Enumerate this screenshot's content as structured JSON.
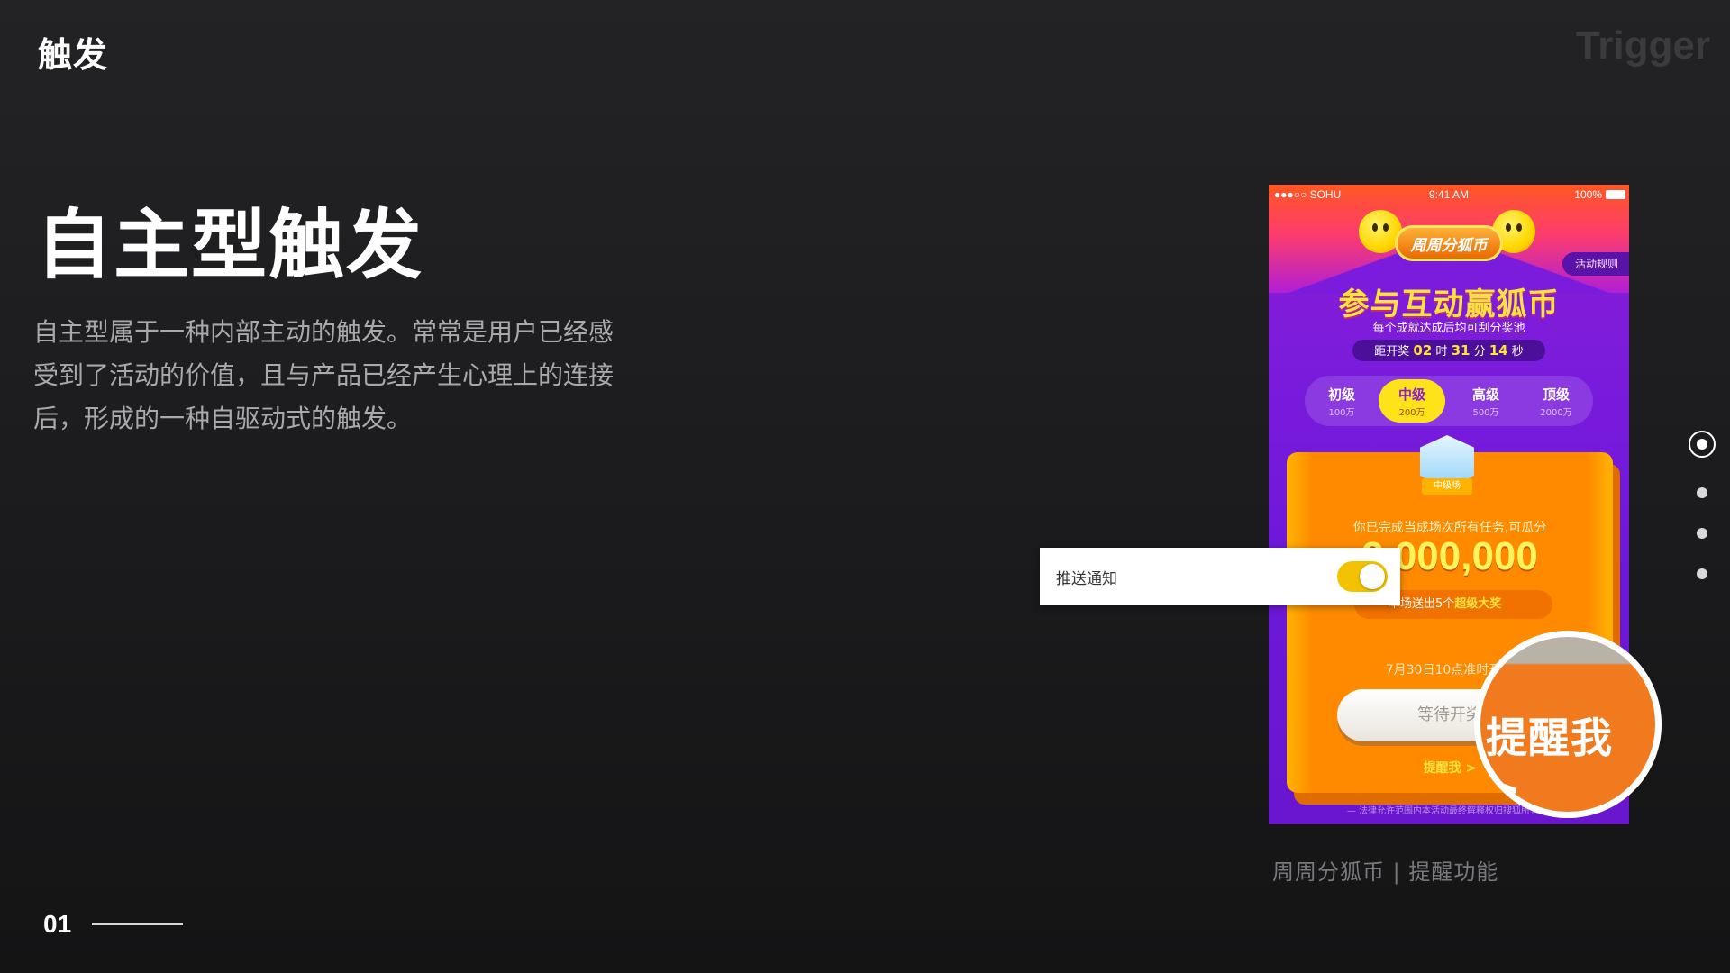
{
  "header": {
    "section_title": "触发",
    "watermark": "Trigger"
  },
  "main": {
    "heading": "自主型触发",
    "description": "自主型属于一种内部主动的触发。常常是用户已经感受到了活动的价值，且与产品已经产生心理上的连接后，形成的一种自驱动式的触发。"
  },
  "phone": {
    "status": {
      "carrier": "●●●○○ SOHU",
      "time": "9:41 AM",
      "battery": "100%"
    },
    "badge": "周周分狐币",
    "rules": "活动规则",
    "title": "参与互动赢狐币",
    "subtitle": "每个成就达成后均可刮分奖池",
    "countdown": {
      "prefix": "距开奖",
      "hours": "02",
      "hours_unit": "时",
      "minutes": "31",
      "minutes_unit": "分",
      "seconds": "14",
      "seconds_unit": "秒"
    },
    "levels": [
      {
        "name": "初级",
        "sub": "100万"
      },
      {
        "name": "中级",
        "sub": "200万"
      },
      {
        "name": "高级",
        "sub": "500万"
      },
      {
        "name": "顶级",
        "sub": "2000万"
      }
    ],
    "card": {
      "level_badge": "中级场",
      "text": "你已完成当成场次所有任务,可瓜分",
      "amount": "2,000,000",
      "pill_prefix": "本场送出5个",
      "pill_highlight": "超级大奖",
      "date": "7月30日10点准时开奖",
      "wait_button": "等待开奖",
      "remind": "提醒我 >"
    },
    "legal": "— 法律允许范围内本活动最终解释权归搜狐所有 —"
  },
  "zoom": {
    "text": "提醒我 >"
  },
  "notification": {
    "label": "推送通知",
    "toggle_on": true
  },
  "caption": "周周分狐币 | 提醒功能",
  "footer": {
    "page_number": "01"
  },
  "pagination": {
    "total": 4,
    "active": 1
  },
  "colors": {
    "background": "#1b1b1d",
    "accent_purple": "#7a1bdc",
    "accent_orange": "#ff8a00",
    "accent_yellow": "#ffe23e",
    "toggle_on": "#f2c200"
  }
}
